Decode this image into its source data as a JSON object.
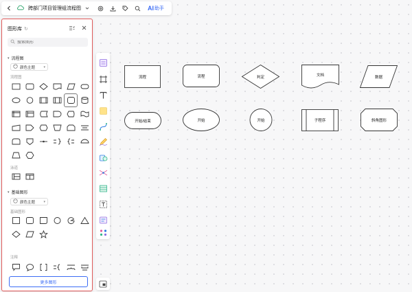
{
  "topbar": {
    "title": "跨部门项目管理组流程图",
    "ai_label": "AI",
    "ai_helper": "助手"
  },
  "library": {
    "title": "图形库",
    "search_placeholder": "搜索图形",
    "flowchart": {
      "section": "流程图",
      "theme": "颜色主题",
      "subcaption": "流程图"
    },
    "swimlane": {
      "subcaption": "泳道"
    },
    "basic": {
      "section": "基础图形",
      "theme": "颜色主题",
      "subcaption": "基础图形",
      "annot_subcaption": "注释"
    },
    "more_button": "更多图形"
  },
  "canvas": {
    "shapes": [
      {
        "label": "流程"
      },
      {
        "label": "流程"
      },
      {
        "label": "判定"
      },
      {
        "label": "文档"
      },
      {
        "label": "数据"
      },
      {
        "label": "开始/结束"
      },
      {
        "label": "开始"
      },
      {
        "label": "开始"
      },
      {
        "label": "子程序"
      },
      {
        "label": "斜角图形"
      }
    ]
  },
  "colors": {
    "accent": "#3b6cf5",
    "panel_border": "#e05a5a",
    "shape_stroke": "#333333"
  }
}
